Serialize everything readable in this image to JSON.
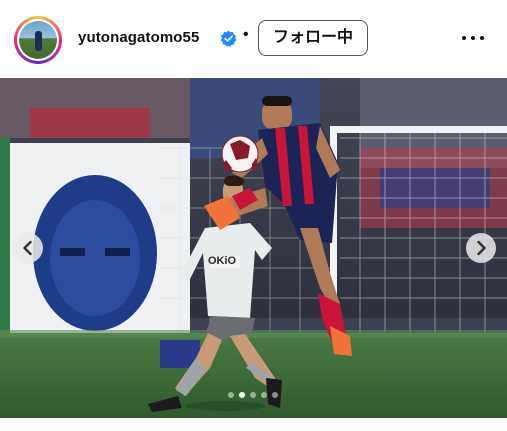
{
  "post_header": {
    "username": "yutonagatomo55",
    "separator": "•",
    "follow_label": "フォロー中",
    "verified_icon": "verified-badge-icon",
    "more_icon": "more-options-icon"
  },
  "media": {
    "ad_text": "OKiO",
    "prev_icon": "chevron-left-icon",
    "next_icon": "chevron-right-icon",
    "carousel_count": 5,
    "carousel_active": 2
  },
  "colors": {
    "verified": "#1a8cff",
    "turf": "#3d6a3a",
    "kit_home": "#1c2456",
    "kit_home_stripe": "#c8163a",
    "kit_away": "#e8ecec"
  }
}
